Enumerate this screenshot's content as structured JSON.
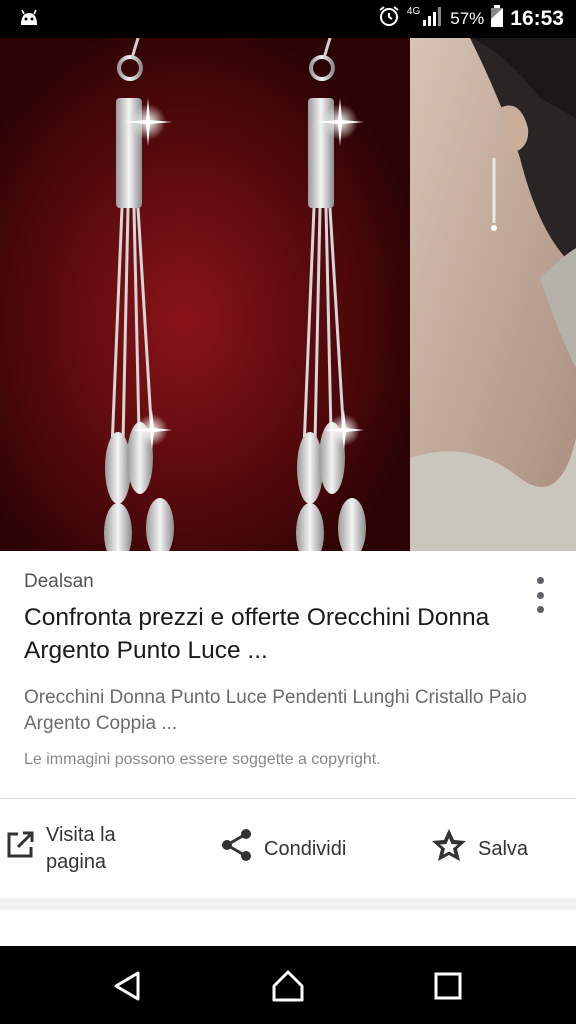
{
  "status_bar": {
    "network_label": "4G",
    "battery": "57%",
    "time": "16:53",
    "icons": [
      "android-icon",
      "alarm-icon",
      "signal-icon",
      "battery-icon"
    ]
  },
  "hero": {
    "description_icon": "earrings-photo"
  },
  "result": {
    "source": "Dealsan",
    "title": "Confronta prezzi e offerte Orecchini Donna Argento Punto Luce ...",
    "description": "Orecchini Donna Punto Luce Pendenti Lunghi Cristallo Paio Argento Coppia ...",
    "copyright_note": "Le immagini possono essere soggette a copyright."
  },
  "actions": {
    "visit_label": "Visita la pagina",
    "share_label": "Condividi",
    "save_label": "Salva"
  },
  "colors": {
    "background": "#ffffff",
    "status_bar": "#000000",
    "hero_bg": "#5a0a0c",
    "text_primary": "#1a1a1a",
    "text_secondary": "#6b6b6b"
  }
}
